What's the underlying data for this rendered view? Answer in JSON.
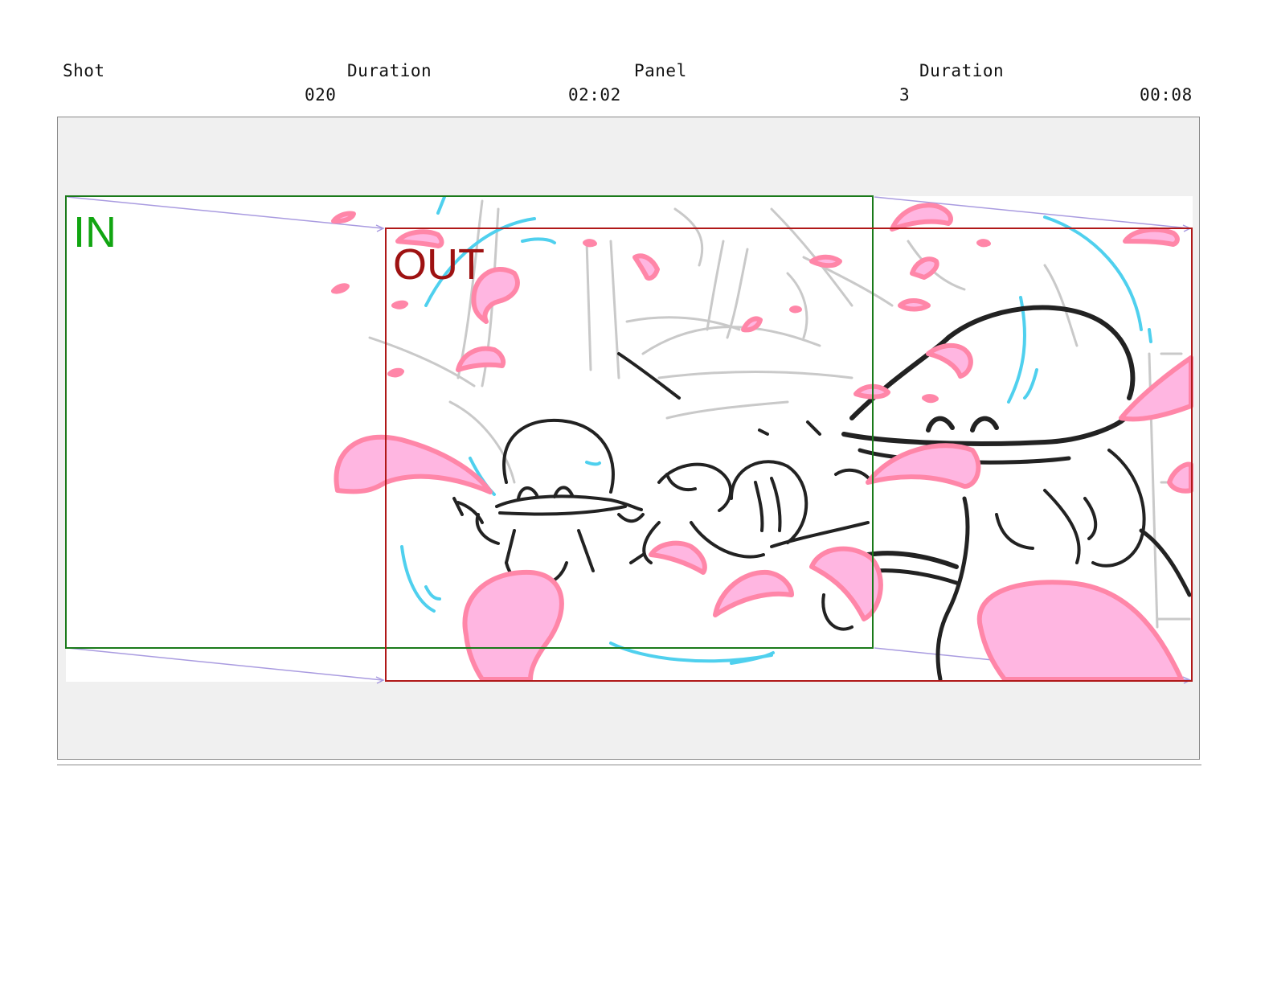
{
  "header": {
    "labels": {
      "shot": "Shot",
      "duration_1": "Duration",
      "panel": "Panel",
      "duration_2": "Duration"
    },
    "values": {
      "shot_number": "020",
      "shot_duration": "02:02",
      "panel_number": "3",
      "panel_duration": "00:08"
    }
  },
  "camera": {
    "in_label": "IN",
    "out_label": "OUT",
    "colors": {
      "in_frame": "#1a7a1a",
      "out_frame": "#b01818",
      "motion_arrows": "#a99be0",
      "petals": "#ff86a8",
      "petal_fill": "#ffb6e1",
      "motion_lines": "#4fd0ee"
    }
  }
}
